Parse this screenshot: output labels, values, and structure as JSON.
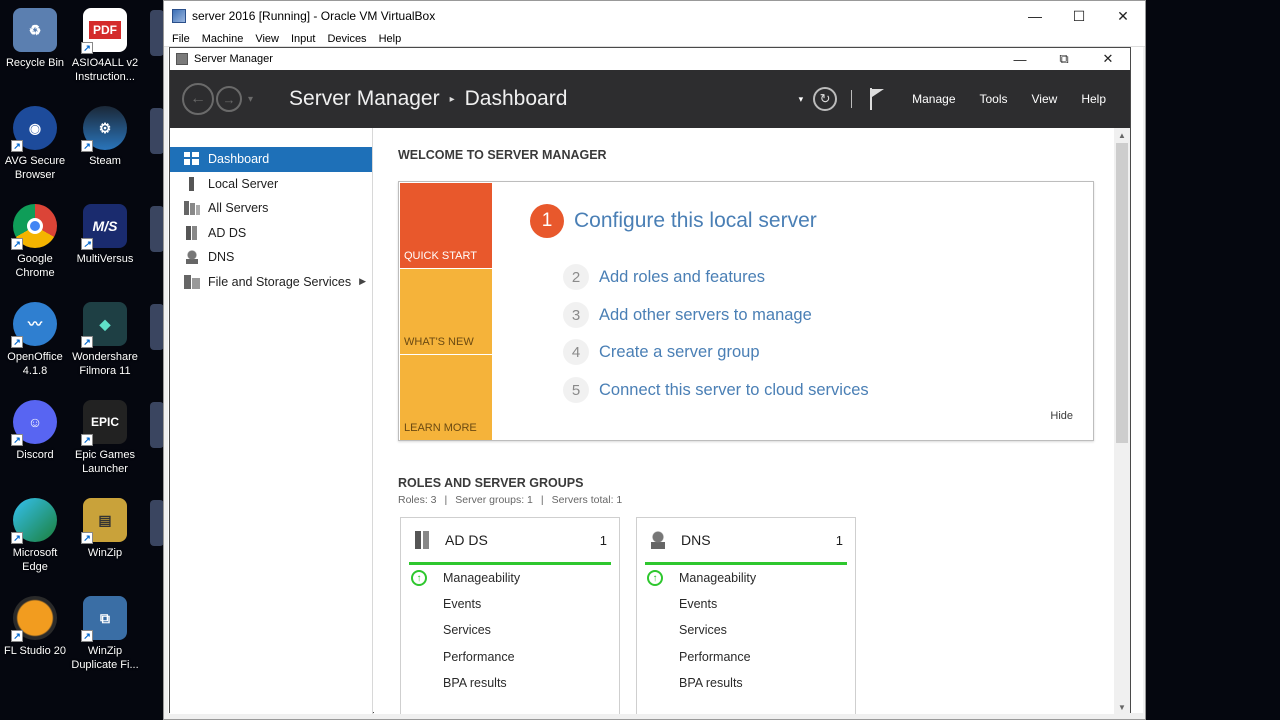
{
  "desktop": {
    "icons": [
      {
        "label": "Recycle Bin",
        "icon": "recycle-bin-icon",
        "color": "#5b7fb0"
      },
      {
        "label": "AVG Secure Browser",
        "icon": "avg-browser-icon",
        "color": "#1d4b9b"
      },
      {
        "label": "Google Chrome",
        "icon": "chrome-icon",
        "color": "#2a8a3c"
      },
      {
        "label": "OpenOffice 4.1.8",
        "icon": "openoffice-icon",
        "color": "#2f7fd0"
      },
      {
        "label": "Discord",
        "icon": "discord-icon",
        "color": "#5865f2"
      },
      {
        "label": "Microsoft Edge",
        "icon": "edge-icon",
        "color": "#1b9aa8"
      },
      {
        "label": "FL Studio 20",
        "icon": "fl-studio-icon",
        "color": "#e08a1c"
      },
      {
        "label": "ASIO4ALL v2 Instruction...",
        "icon": "pdf-icon",
        "color": "#d42b2b"
      },
      {
        "label": "Steam",
        "icon": "steam-icon",
        "color": "#1b2838"
      },
      {
        "label": "MultiVersus",
        "icon": "multiversus-icon",
        "color": "#1a2b6e"
      },
      {
        "label": "Wondershare Filmora 11",
        "icon": "filmora-icon",
        "color": "#1e3f44"
      },
      {
        "label": "Epic Games Launcher",
        "icon": "epic-games-icon",
        "color": "#222222"
      },
      {
        "label": "WinZip",
        "icon": "winzip-icon",
        "color": "#c9a23a"
      },
      {
        "label": "WinZip Duplicate Fi...",
        "icon": "winzip-duplicate-icon",
        "color": "#3a6ea5"
      }
    ]
  },
  "vbox": {
    "title": "server 2016 [Running] - Oracle VM VirtualBox",
    "menu": [
      "File",
      "Machine",
      "View",
      "Input",
      "Devices",
      "Help"
    ],
    "minimize": "—",
    "maximize": "☐",
    "close": "✕"
  },
  "sm": {
    "title": "Server Manager",
    "breadcrumb_app": "Server Manager",
    "breadcrumb_page": "Dashboard",
    "header_menu": [
      "Manage",
      "Tools",
      "View",
      "Help"
    ],
    "nav": [
      {
        "label": "Dashboard",
        "active": true
      },
      {
        "label": "Local Server"
      },
      {
        "label": "All Servers"
      },
      {
        "label": "AD DS"
      },
      {
        "label": "DNS"
      },
      {
        "label": "File and Storage Services"
      }
    ],
    "welcome": {
      "heading": "WELCOME TO SERVER MANAGER",
      "tiles": [
        "QUICK START",
        "WHAT'S NEW",
        "LEARN MORE"
      ],
      "step1_num": "1",
      "step1": "Configure this local server",
      "steps": [
        {
          "num": "2",
          "text": "Add roles and features"
        },
        {
          "num": "3",
          "text": "Add other servers to manage"
        },
        {
          "num": "4",
          "text": "Create a server group"
        },
        {
          "num": "5",
          "text": "Connect this server to cloud services"
        }
      ],
      "hide": "Hide"
    },
    "roles": {
      "heading": "ROLES AND SERVER GROUPS",
      "roles_count": "Roles: 3",
      "groups_count": "Server groups: 1",
      "servers_total": "Servers total: 1",
      "cards": [
        {
          "title": "AD DS",
          "count": "1",
          "rows": [
            "Manageability",
            "Events",
            "Services",
            "Performance",
            "BPA results"
          ]
        },
        {
          "title": "DNS",
          "count": "1",
          "rows": [
            "Manageability",
            "Events",
            "Services",
            "Performance",
            "BPA results"
          ]
        }
      ]
    }
  }
}
